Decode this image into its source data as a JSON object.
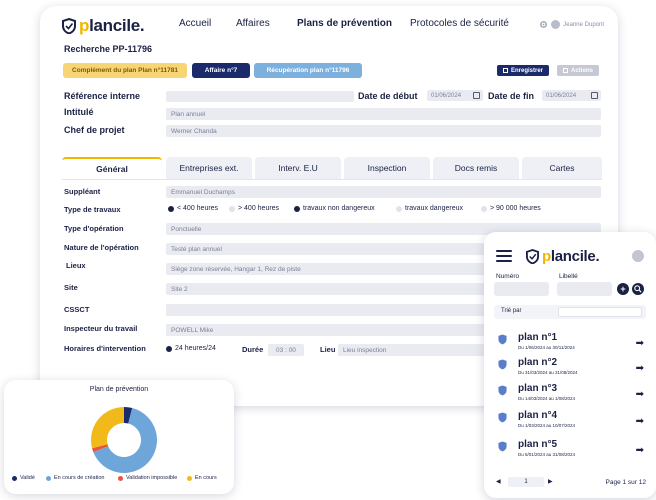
{
  "brand": {
    "name_prefix": "",
    "name_p": "p",
    "name_rest": "lancile."
  },
  "nav": {
    "accueil": "Accueil",
    "affaires": "Affaires",
    "plans": "Plans de prévention",
    "protocoles": "Protocoles de sécurité"
  },
  "user": {
    "name": "Jeanne Dupont"
  },
  "search": {
    "title": "Recherche  PP-11796"
  },
  "badges": {
    "complement": "Complément du plan Plan n°11781",
    "affaire": "Affaire n°7",
    "recuperation": "Récupération plan n°11796"
  },
  "actions": {
    "save": "Enregistrer",
    "actions": "Actions"
  },
  "header_form": {
    "ref_label": "Référence interne",
    "date_debut_label": "Date de début",
    "date_debut": "01/06/2024",
    "date_fin_label": "Date de fin",
    "date_fin": "01/06/2024",
    "intitule_label": "Intitulé",
    "intitule": "Plan annuel",
    "chef_label": "Chef de projet",
    "chef": "Werner Chanda"
  },
  "tabs": [
    "Général",
    "Entreprises ext.",
    "Interv. E.U",
    "Inspection",
    "Docs remis",
    "Cartes"
  ],
  "general": {
    "suppleant_label": "Suppléant",
    "suppleant": "Emmanuel Duchamps",
    "type_travaux_label": "Type de travaux",
    "radios": [
      "< 400 heures",
      "> 400 heures",
      "travaux non dangereux",
      "travaux dangereux",
      "> 90 000 heures"
    ],
    "type_operation_label": "Type d'opération",
    "type_operation": "Ponctuelle",
    "nature_label": "Nature de l'opération",
    "nature": "Testé plan annuel",
    "lieux_label": "Lieux",
    "lieux": "Siège zone réservée, Hangar 1, Rez de piste",
    "site_label": "Site",
    "site": "Site 2",
    "cssct_label": "CSSCT",
    "inspecteur_label": "Inspecteur du travail",
    "inspecteur": "POWELL Mike",
    "horaires_label": "Horaires d'intervention",
    "horaires_value": "24 heures/24",
    "duree_label": "Durée",
    "duree": "03 : 00",
    "lieu_label": "Lieu",
    "lieu_placeholder": "Lieu inspection"
  },
  "chart_data": {
    "type": "pie",
    "title": "Plan de prévention",
    "categories": [
      "Validé",
      "En cours de création",
      "Validation impossible",
      "En cours"
    ],
    "values": [
      4,
      65,
      2,
      29
    ],
    "colors": [
      "#1b2a6b",
      "#6fa6da",
      "#e8553f",
      "#f2b91a"
    ]
  },
  "mobile": {
    "numero_label": "Numéro",
    "libelle_label": "Libellé",
    "trie_label": "Trié par",
    "items": [
      {
        "title": "plan n°1",
        "dates": "Du 1/06/2024 au 30/11/2024"
      },
      {
        "title": "plan n°2",
        "dates": "Du 31/03/2024 au 31/08/2024"
      },
      {
        "title": "plan n°3",
        "dates": "Du 14/03/2024 au 1/08/2024"
      },
      {
        "title": "plan n°4",
        "dates": "Du 1/03/2024 au 10/07/2024"
      },
      {
        "title": "plan n°5",
        "dates": "Du 5/01/2024 au 31/08/2024"
      }
    ],
    "page_select": "1",
    "page_text": "Page 1 sur 12"
  }
}
